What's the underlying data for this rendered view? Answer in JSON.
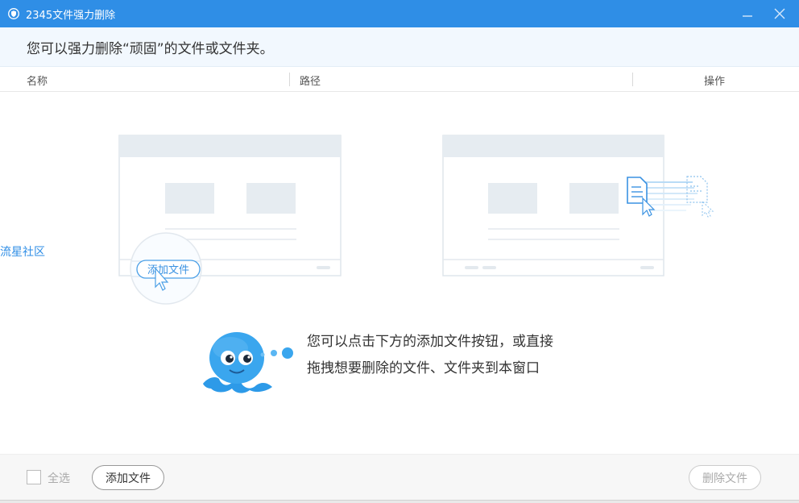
{
  "window": {
    "title": "2345文件强力删除"
  },
  "banner": {
    "text": "您可以强力删除“顽固”的文件或文件夹。"
  },
  "columns": {
    "name": "名称",
    "path": "路径",
    "operation": "操作"
  },
  "overlay": {
    "link_text": "流星社区"
  },
  "illustration": {
    "add_file_pill": "添加文件"
  },
  "hint": {
    "line1": "您可以点击下方的添加文件按钮，或直接",
    "line2": "拖拽想要删除的文件、文件夹到本窗口"
  },
  "footer": {
    "select_all": "全选",
    "add_file": "添加文件",
    "delete_file": "删除文件"
  },
  "colors": {
    "title_bar": "#2f8ee6",
    "banner_bg": "#f2f8fe",
    "accent": "#2f8ee6"
  }
}
